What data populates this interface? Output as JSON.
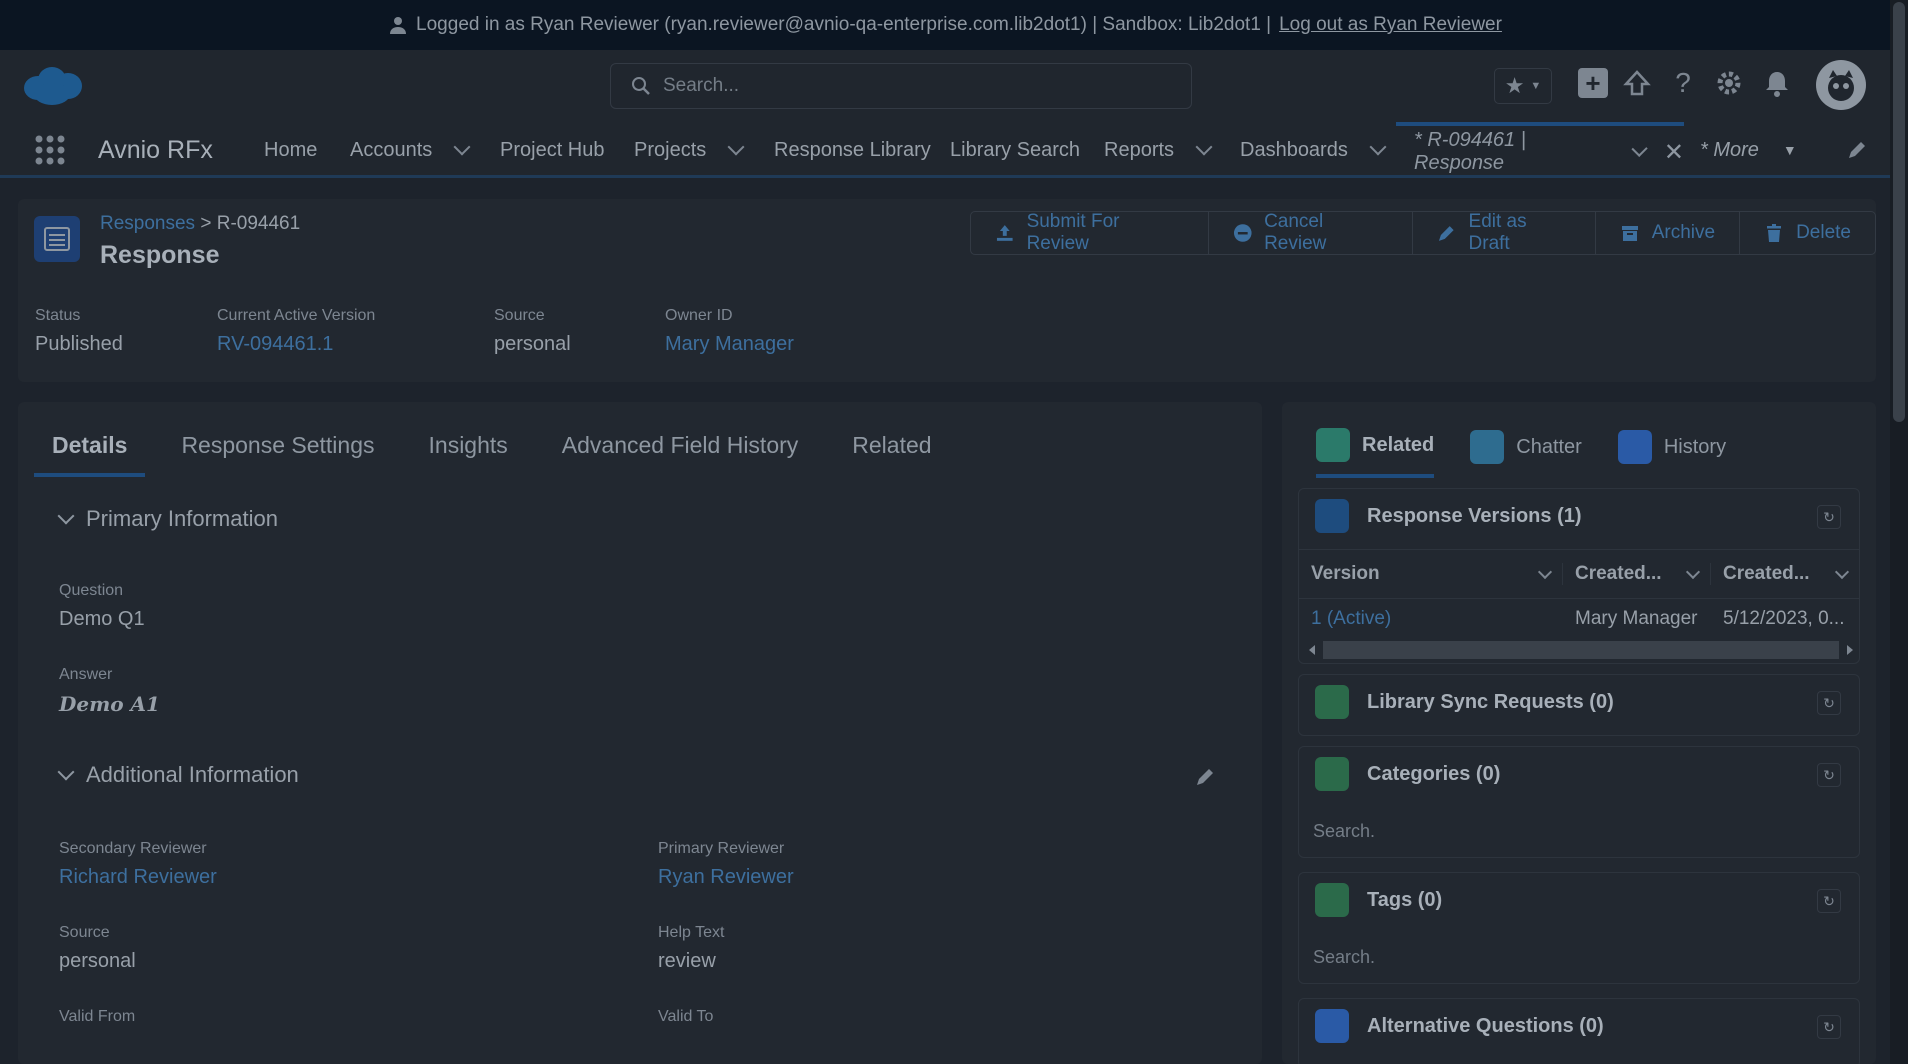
{
  "banner": {
    "text": "Logged in as Ryan Reviewer (ryan.reviewer@avnio-qa-enterprise.com.lib2dot1) | Sandbox: Lib2dot1 |",
    "logout": "Log out as Ryan Reviewer"
  },
  "global": {
    "search_placeholder": "Search..."
  },
  "nav": {
    "app_name": "Avnio RFx",
    "items": [
      {
        "label": "Home"
      },
      {
        "label": "Accounts"
      },
      {
        "label": "Project Hub"
      },
      {
        "label": "Projects"
      },
      {
        "label": "Response Library"
      },
      {
        "label": "Library Search"
      },
      {
        "label": "Reports"
      },
      {
        "label": "Dashboards"
      }
    ],
    "active_tab": "* R-094461 | Response",
    "more": "* More"
  },
  "record": {
    "breadcrumb_parent": "Responses",
    "breadcrumb_sep": ">",
    "breadcrumb_current": "R-094461",
    "title": "Response",
    "actions": [
      "Submit For Review",
      "Cancel Review",
      "Edit as Draft",
      "Archive",
      "Delete"
    ],
    "fields": [
      {
        "label": "Status",
        "value": "Published"
      },
      {
        "label": "Current Active Version",
        "value": "RV-094461.1"
      },
      {
        "label": "Source",
        "value": "personal"
      },
      {
        "label": "Owner ID",
        "value": "Mary Manager"
      }
    ]
  },
  "detail": {
    "tabs": [
      "Details",
      "Response Settings",
      "Insights",
      "Advanced Field History",
      "Related"
    ],
    "primary_section": "Primary Information",
    "question_label": "Question",
    "question_value": "Demo Q1",
    "answer_label": "Answer",
    "answer_value": "Demo A1",
    "additional_section": "Additional Information",
    "secondary_reviewer_label": "Secondary Reviewer",
    "secondary_reviewer_value": "Richard Reviewer",
    "primary_reviewer_label": "Primary Reviewer",
    "primary_reviewer_value": "Ryan Reviewer",
    "source_label": "Source",
    "source_value": "personal",
    "help_text_label": "Help Text",
    "help_text_value": "review",
    "valid_from_label": "Valid From",
    "valid_to_label": "Valid To"
  },
  "sidebar": {
    "tabs": [
      "Related",
      "Chatter",
      "History"
    ],
    "versions_title": "Response Versions (1)",
    "versions_headers": [
      "Version",
      "Created...",
      "Created..."
    ],
    "versions_row": [
      "1 (Active)",
      "Mary Manager",
      "5/12/2023, 0..."
    ],
    "sync_title": "Library Sync Requests (0)",
    "categories_title": "Categories (0)",
    "categories_search": "Search.",
    "tags_title": "Tags (0)",
    "tags_search": "Search.",
    "alt_questions_title": "Alternative Questions (0)"
  },
  "colors": {
    "link": "#3d6f9e",
    "brand": "#1e4c7e",
    "related_icon": "#2b7a6a",
    "chatter_icon": "#2e6c8f",
    "history_icon": "#2a5aa6"
  }
}
